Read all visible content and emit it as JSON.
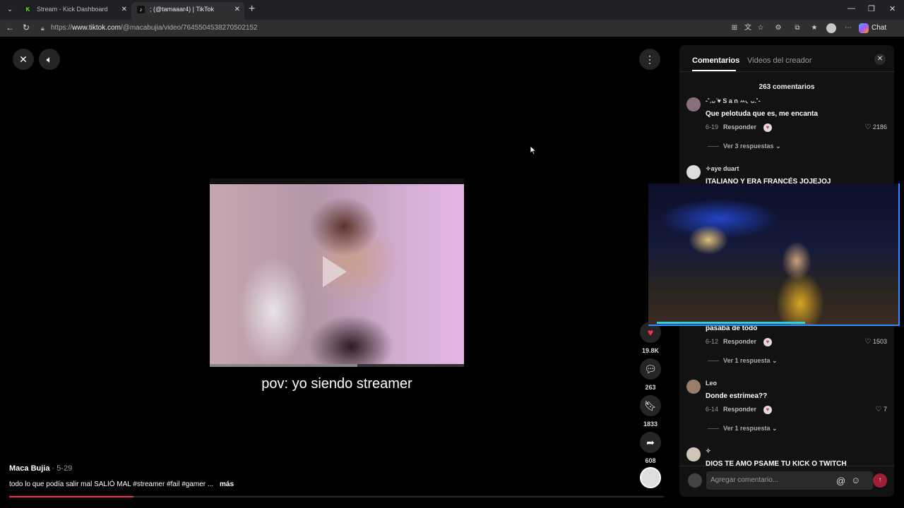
{
  "browser": {
    "tabs": [
      {
        "title": "Stream - Kick Dashboard",
        "icon": "kick-icon"
      },
      {
        "title": "; (@tamaaar4) | TikTok",
        "icon": "tiktok-icon"
      }
    ],
    "url_prefix": "https://",
    "url_host": "www.tiktok.com",
    "url_path": "/@macabujia/video/7645504538270502152",
    "chat_label": "Chat"
  },
  "video": {
    "caption": "pov: yo siendo streamer",
    "progress": 0.58,
    "playback_progress": 0.19
  },
  "post": {
    "author": "Maca Bujia",
    "date": "· 5-29",
    "description": "todo lo que podía salir mal SALIÓ MAL #streamer #fail #gamer ...",
    "more": "más"
  },
  "actions": {
    "likes": "19.8K",
    "comments": "263",
    "saves": "1833",
    "shares": "608"
  },
  "panel": {
    "tab_comments": "Comentarios",
    "tab_creator_videos": "Videos del creador",
    "count": "263 comentarios",
    "comments": [
      {
        "user": "-˚.ᴗ ̈♥ S a n ꕀ◟ᴗ.˚-",
        "text": "Que pelotuda que es, me encanta",
        "date": "6-19",
        "reply": "Responder",
        "likes": "2186",
        "more": "Ver 3 respuestas"
      },
      {
        "user": "✧aye duart",
        "text": "ITALIANO Y ERA FRANCÉS JOJEJOJ",
        "date": "",
        "reply": "",
        "likes": "",
        "more": ""
      },
      {
        "user": "",
        "text": "pasaba de todo",
        "date": "6-12",
        "reply": "Responder",
        "likes": "1503",
        "more": "Ver 1 respuesta"
      },
      {
        "user": "Leo",
        "text": "Donde estrimea??",
        "date": "6-14",
        "reply": "Responder",
        "likes": "7",
        "more": "Ver 1 respuesta"
      },
      {
        "user": "✧",
        "text": "DIOS TE AMO PSAME TU KICK O TWITCH",
        "date": "",
        "reply": "",
        "likes": "",
        "more": ""
      }
    ],
    "composer_placeholder": "Agregar comentario..."
  },
  "colors": {
    "tiktok_red": "#fe2c55",
    "panel_bg": "#121212",
    "webcam_border": "#2d8cff"
  }
}
